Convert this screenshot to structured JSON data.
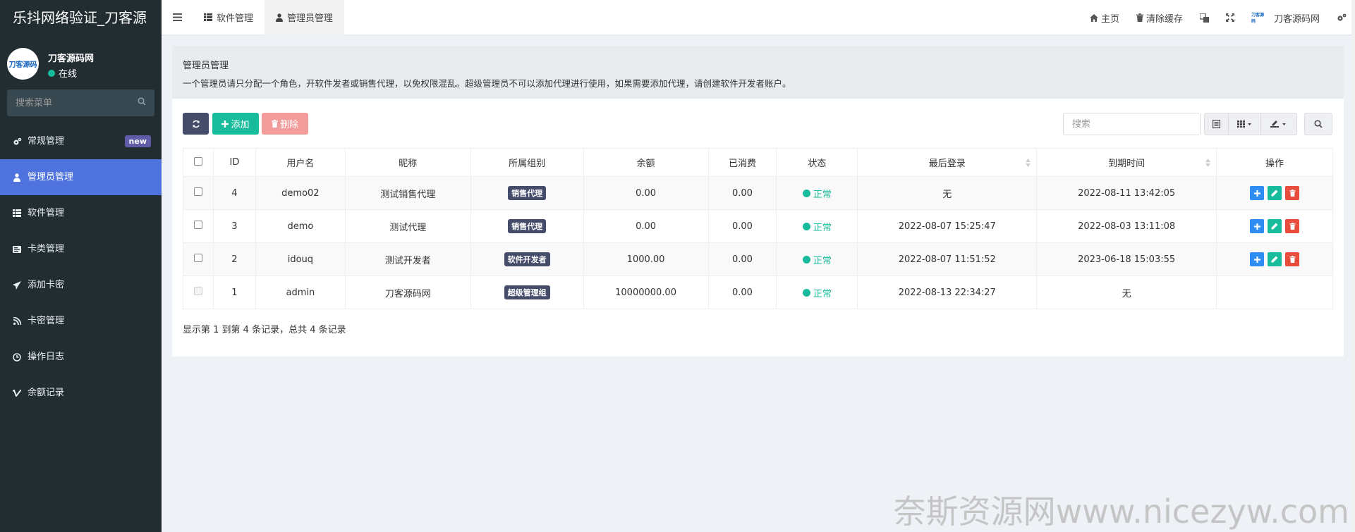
{
  "app_title": "乐抖网络验证_刀客源",
  "user": {
    "name": "刀客源码网",
    "status": "在线",
    "avatar_text": "刀客源码"
  },
  "sidebar": {
    "search_placeholder": "搜索菜单",
    "items": [
      {
        "label": "常规管理",
        "icon": "cogs-icon",
        "badge": "new"
      },
      {
        "label": "管理员管理",
        "icon": "user-icon",
        "active": true
      },
      {
        "label": "软件管理",
        "icon": "list-icon"
      },
      {
        "label": "卡类管理",
        "icon": "card-list-icon"
      },
      {
        "label": "添加卡密",
        "icon": "send-icon"
      },
      {
        "label": "卡密管理",
        "icon": "rss-icon"
      },
      {
        "label": "操作日志",
        "icon": "clock-icon"
      },
      {
        "label": "余额记录",
        "icon": "vimeo-icon"
      }
    ]
  },
  "topbar": {
    "tabs": [
      {
        "label": "软件管理",
        "icon": "list-icon"
      },
      {
        "label": "管理员管理",
        "icon": "user-icon",
        "active": true
      }
    ],
    "right": {
      "home": "主页",
      "clear_cache": "清除缓存",
      "user": "刀客源码网",
      "logo_text": "刀客源码"
    }
  },
  "panel": {
    "title": "管理员管理",
    "description": "一个管理员请只分配一个角色，开软件发者或销售代理，以免权限混乱。超级管理员不可以添加代理进行使用，如果需要添加代理，请创建软件开发者账户。"
  },
  "toolbar": {
    "add_label": "添加",
    "delete_label": "删除",
    "search_placeholder": "搜索"
  },
  "table": {
    "headers": [
      "ID",
      "用户名",
      "昵称",
      "所属组别",
      "余额",
      "已消费",
      "状态",
      "最后登录",
      "到期时间",
      "操作"
    ],
    "rows": [
      {
        "id": "4",
        "username": "demo02",
        "nickname": "测试销售代理",
        "group": "销售代理",
        "balance": "0.00",
        "spent": "0.00",
        "status": "正常",
        "last_login": "无",
        "expire": "2022-08-11 13:42:05",
        "ops": true
      },
      {
        "id": "3",
        "username": "demo",
        "nickname": "测试代理",
        "group": "销售代理",
        "balance": "0.00",
        "spent": "0.00",
        "status": "正常",
        "last_login": "2022-08-07 15:25:47",
        "expire": "2022-08-03 13:11:08",
        "ops": true
      },
      {
        "id": "2",
        "username": "idouq",
        "nickname": "测试开发者",
        "group": "软件开发者",
        "balance": "1000.00",
        "spent": "0.00",
        "status": "正常",
        "last_login": "2022-08-07 11:51:52",
        "expire": "2023-06-18 15:03:55",
        "ops": true
      },
      {
        "id": "1",
        "username": "admin",
        "nickname": "刀客源码网",
        "group": "超级管理组",
        "balance": "10000000.00",
        "spent": "0.00",
        "status": "正常",
        "last_login": "2022-08-13 22:34:27",
        "expire": "无",
        "ops": false
      }
    ]
  },
  "pager_info": "显示第 1 到第 4 条记录，总共 4 条记录",
  "watermark": "奈斯资源网www.nicezyw.com",
  "colors": {
    "sidebar_bg": "#222d32",
    "active_menu": "#4e73df",
    "success": "#18bc9c",
    "danger": "#e74c3c",
    "primary": "#2f8cf0",
    "dark_btn": "#444c69"
  }
}
